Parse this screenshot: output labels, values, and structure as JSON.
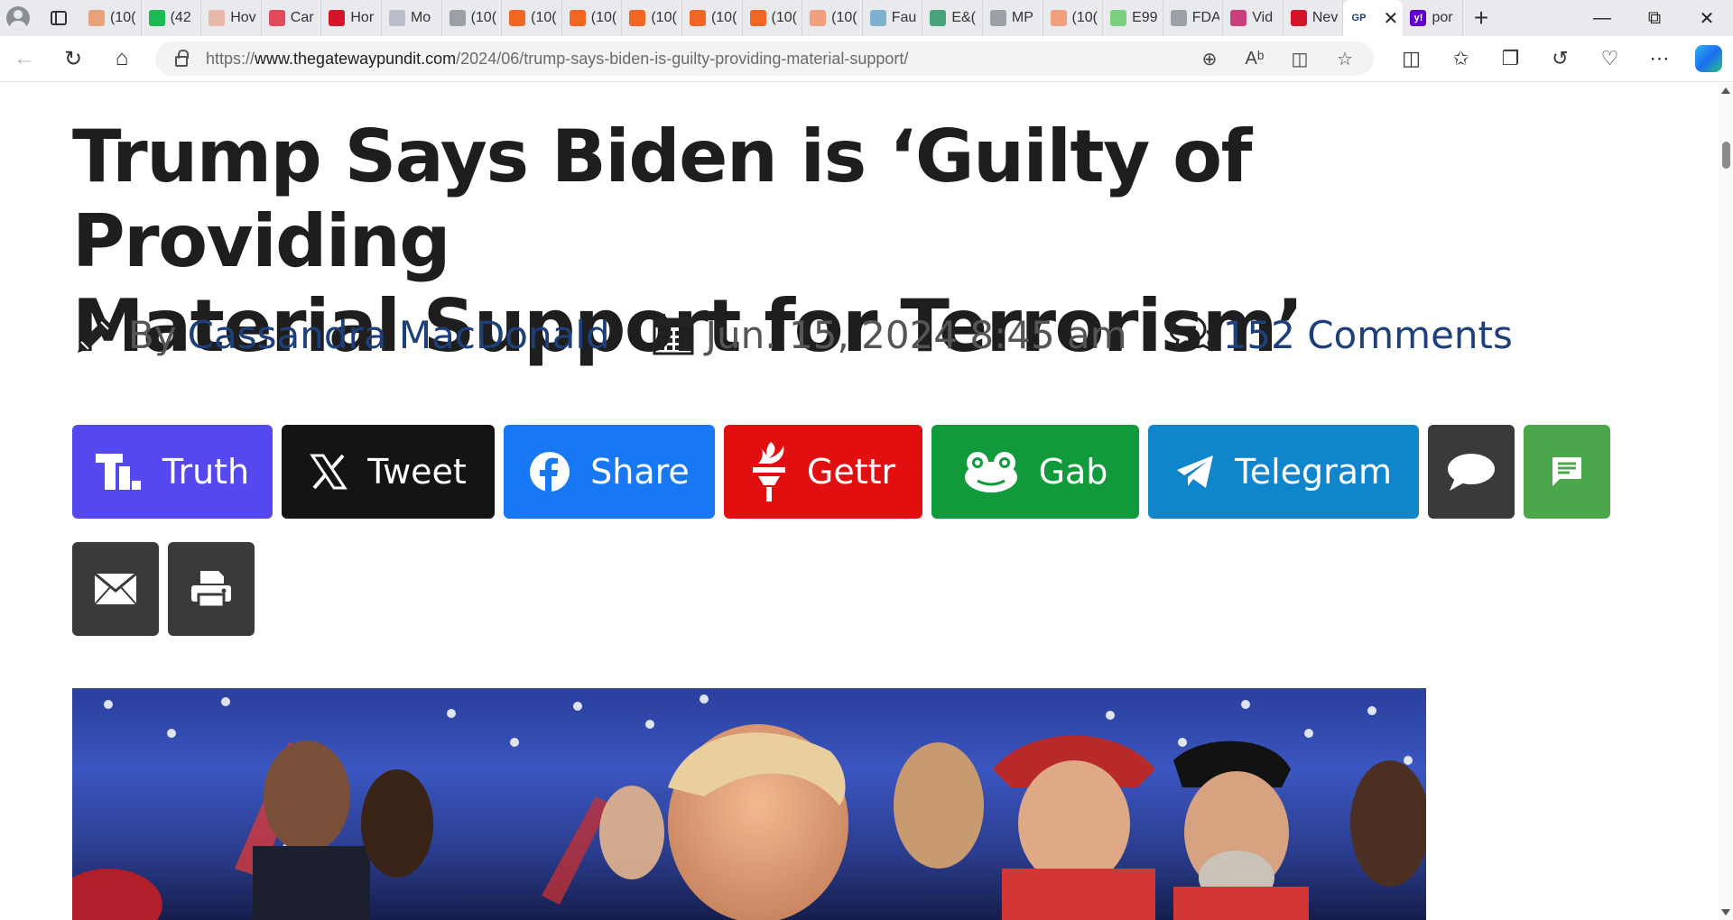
{
  "browser": {
    "tabs": [
      {
        "label": "(10(",
        "color": "#e8a27a"
      },
      {
        "label": "(42",
        "color": "#1db954"
      },
      {
        "label": "Hov",
        "color": "#e6b8a8"
      },
      {
        "label": "Car",
        "color": "#e04a5a"
      },
      {
        "label": "Hor",
        "color": "#d4142a"
      },
      {
        "label": "Mo",
        "color": "#b9bdc9"
      },
      {
        "label": "(10(",
        "color": "#9aa0a6"
      },
      {
        "label": "(10(",
        "color": "#f16622"
      },
      {
        "label": "(10(",
        "color": "#f16622"
      },
      {
        "label": "(10(",
        "color": "#f16622"
      },
      {
        "label": "(10(",
        "color": "#f16622"
      },
      {
        "label": "(10(",
        "color": "#f16622"
      },
      {
        "label": "(10(",
        "color": "#f0a17c"
      },
      {
        "label": "Fau",
        "color": "#7fb0d0"
      },
      {
        "label": "E&(",
        "color": "#4aa37a"
      },
      {
        "label": "MP",
        "color": "#9aa0a6"
      },
      {
        "label": "(10(",
        "color": "#f0a17c"
      },
      {
        "label": "E99",
        "color": "#7ccf7e"
      },
      {
        "label": "FDA",
        "color": "#9aa0a6"
      },
      {
        "label": "Vid",
        "color": "#c9417c"
      },
      {
        "label": "Nev",
        "color": "#d4142a"
      },
      {
        "label": "GP",
        "color": "#1d3f7a",
        "favtext": "GP"
      },
      {
        "label": "por",
        "color": "#6001d2",
        "favtext": "y!"
      }
    ],
    "url_scheme": "https://",
    "url_host": "www.thegatewaypundit.com",
    "url_path": "/2024/06/trump-says-biden-is-guilty-providing-material-support/"
  },
  "article": {
    "headline_line1": "Trump Says Biden is ‘Guilty of Providing",
    "headline_line2": "Material Support for Terrorism’",
    "by_label": "By",
    "author": "Cassandra MacDonald",
    "date": "Jun. 15, 2024 8:45 am",
    "comments": "152 Comments"
  },
  "share_buttons": {
    "truth": {
      "label": "Truth",
      "color": "#5448ee",
      "icon": "truth-social-icon"
    },
    "tweet": {
      "label": "Tweet",
      "color": "#141414",
      "icon": "x-icon"
    },
    "share": {
      "label": "Share",
      "color": "#1877f2",
      "icon": "facebook-icon"
    },
    "gettr": {
      "label": "Gettr",
      "color": "#e10f0f",
      "icon": "gettr-torch-icon"
    },
    "gab": {
      "label": "Gab",
      "color": "#109a3c",
      "icon": "gab-frog-icon"
    },
    "telegram": {
      "label": "Telegram",
      "color": "#0f86cc",
      "icon": "telegram-icon"
    },
    "comment": {
      "color": "#3a3a3a",
      "icon": "speech-bubble-icon"
    },
    "sms": {
      "color": "#4ca64c",
      "icon": "sms-icon"
    },
    "email": {
      "color": "#3a3a3a",
      "icon": "envelope-icon"
    },
    "print": {
      "color": "#3a3a3a",
      "icon": "printer-icon"
    }
  }
}
